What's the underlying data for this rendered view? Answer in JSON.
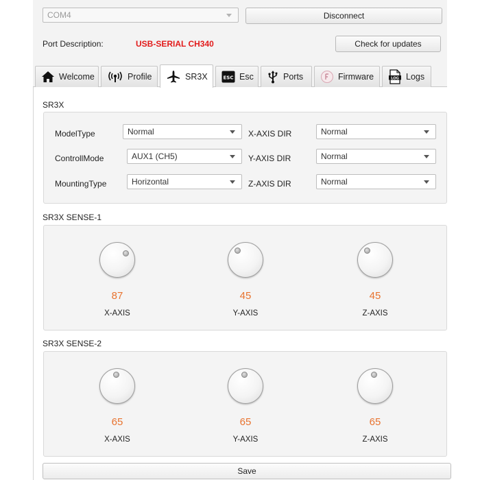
{
  "connection": {
    "port": "COM4",
    "disconnect_label": "Disconnect",
    "port_description_label": "Port Description:",
    "port_description_value": "USB-SERIAL CH340",
    "check_updates_label": "Check for updates"
  },
  "tabs": [
    {
      "label": "Welcome",
      "icon": "home-icon"
    },
    {
      "label": "Profile",
      "icon": "wireless-icon"
    },
    {
      "label": "SR3X",
      "icon": "airplane-icon",
      "active": true
    },
    {
      "label": "Esc",
      "icon": "esc-icon"
    },
    {
      "label": "Ports",
      "icon": "usb-icon"
    },
    {
      "label": "Firmware",
      "icon": "firmware-icon"
    },
    {
      "label": "Logs",
      "icon": "log-icon"
    }
  ],
  "sr3x": {
    "title": "SR3X",
    "model_type_label": "ModelType",
    "model_type_value": "Normal",
    "controll_mode_label": "ControllMode",
    "controll_mode_value": "AUX1 (CH5)",
    "mounting_type_label": "MountingType",
    "mounting_type_value": "Horizontal",
    "x_axis_dir_label": "X-AXIS DIR",
    "x_axis_dir_value": "Normal",
    "y_axis_dir_label": "Y-AXIS DIR",
    "y_axis_dir_value": "Normal",
    "z_axis_dir_label": "Z-AXIS DIR",
    "z_axis_dir_value": "Normal"
  },
  "sense1": {
    "title": "SR3X SENSE-1",
    "knobs": [
      {
        "label": "X-AXIS",
        "value": "87"
      },
      {
        "label": "Y-AXIS",
        "value": "45"
      },
      {
        "label": "Z-AXIS",
        "value": "45"
      }
    ]
  },
  "sense2": {
    "title": "SR3X SENSE-2",
    "knobs": [
      {
        "label": "X-AXIS",
        "value": "65"
      },
      {
        "label": "Y-AXIS",
        "value": "65"
      },
      {
        "label": "Z-AXIS",
        "value": "65"
      }
    ]
  },
  "save_label": "Save",
  "colors": {
    "port_description": "#e21b1b",
    "knob_value": "#e8732f"
  }
}
